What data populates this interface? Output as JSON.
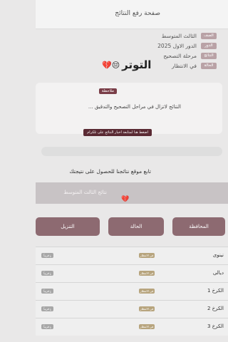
{
  "header": {
    "title": "صفحة رفع النتائج"
  },
  "info": [
    {
      "tag": "الصف",
      "value": "الثالث المتوسط"
    },
    {
      "tag": "الدور",
      "value": "الدور الاول 2025"
    },
    {
      "tag": "النتائج",
      "value": "مرحلة التصحيح"
    },
    {
      "tag": "الحالة",
      "value": "في الانتظار"
    }
  ],
  "overlay": {
    "text": "التوتر",
    "emoji": "😔💔"
  },
  "note": {
    "badge": "ملاحظة",
    "line1": "النتائج لاتزال في مراحل التصحيح والتدقيق ...",
    "cta": "اضغط هنا لمتابعة اخبار النتائج على تلكرام"
  },
  "follow_text": "تابع موقع نتائجنا للحصول على نتيجتك",
  "banner": {
    "text": "نتائج الثالث المتوسط",
    "heart": "💔"
  },
  "table": {
    "headers": [
      "المحافظة",
      "الحالة",
      "التنزيل"
    ],
    "rows": [
      {
        "gov": "نينوى",
        "status": "في الانتظار",
        "download": "قريباً"
      },
      {
        "gov": "ديالى",
        "status": "في الانتظار",
        "download": "قريباً"
      },
      {
        "gov": "الكرخ 1",
        "status": "في الانتظار",
        "download": "قريباً"
      },
      {
        "gov": "الكرخ 2",
        "status": "في الانتظار",
        "download": "قريباً"
      },
      {
        "gov": "الكرخ 3",
        "status": "في الانتظار",
        "download": "قريباً"
      },
      {
        "gov": "",
        "status": "",
        "download": ""
      }
    ]
  },
  "colors": {
    "accent": "#7a3e48",
    "tab": "#8d6a71",
    "pending": "#b7a47d"
  }
}
